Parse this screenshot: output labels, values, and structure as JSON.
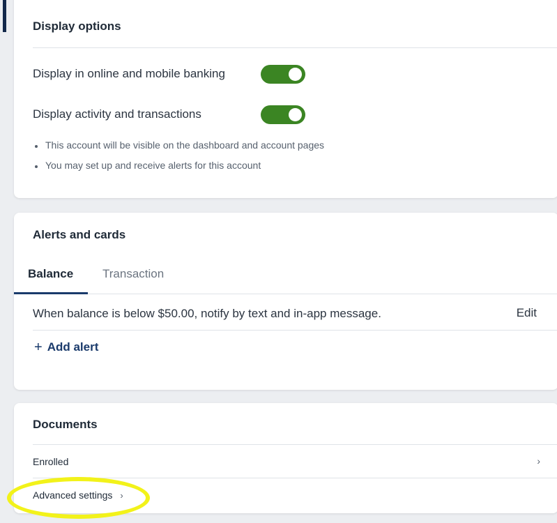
{
  "display_options": {
    "title": "Display options",
    "toggles": [
      {
        "label": "Display in online and mobile banking",
        "on": true
      },
      {
        "label": "Display activity and transactions",
        "on": true
      }
    ],
    "notes": [
      "This account will be visible on the dashboard and account pages",
      "You may set up and receive alerts for this account"
    ]
  },
  "alerts_cards": {
    "title": "Alerts and cards",
    "tabs": [
      {
        "label": "Balance",
        "active": true
      },
      {
        "label": "Transaction",
        "active": false
      }
    ],
    "alert_text": "When balance is below $50.00, notify by text and in-app message.",
    "edit_label": "Edit",
    "add_alert_label": "Add alert",
    "add_alert_icon": "+"
  },
  "documents": {
    "title": "Documents",
    "rows": [
      {
        "label": "Enrolled"
      },
      {
        "label": "Advanced settings"
      }
    ]
  },
  "colors": {
    "toggle_on": "#3b8523",
    "link": "#1a3a6b",
    "highlight": "#f2f21a"
  }
}
